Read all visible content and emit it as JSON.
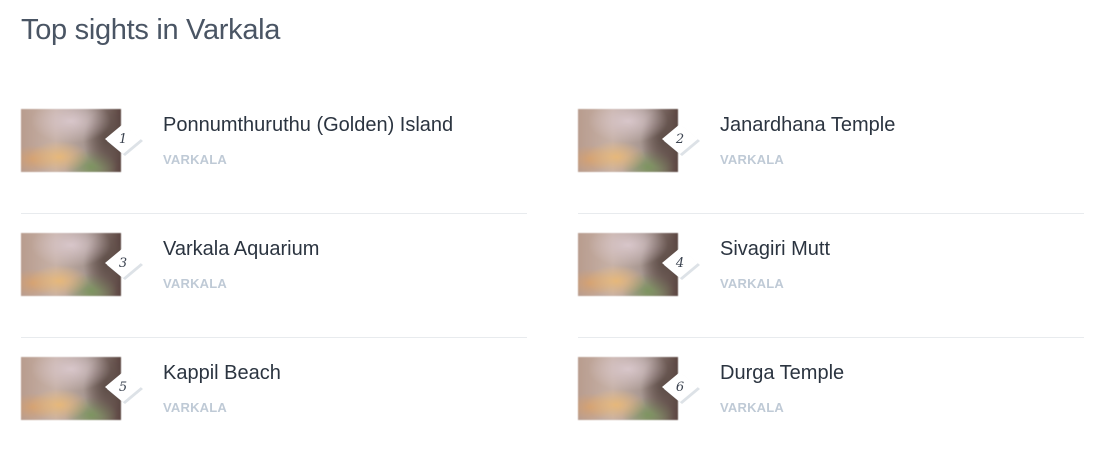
{
  "page": {
    "title": "Top sights in Varkala"
  },
  "sights": [
    {
      "rank": "1",
      "name": "Ponnumthuruthu (Golden) Island",
      "location": "VARKALA"
    },
    {
      "rank": "2",
      "name": "Janardhana Temple",
      "location": "VARKALA"
    },
    {
      "rank": "3",
      "name": "Varkala Aquarium",
      "location": "VARKALA"
    },
    {
      "rank": "4",
      "name": "Sivagiri Mutt",
      "location": "VARKALA"
    },
    {
      "rank": "5",
      "name": "Kappil Beach",
      "location": "VARKALA"
    },
    {
      "rank": "6",
      "name": "Durga Temple",
      "location": "VARKALA"
    }
  ],
  "colors": {
    "title": "#4a5564",
    "name": "#2b3440",
    "location": "#bfcad6",
    "divider": "#e8ebee"
  }
}
